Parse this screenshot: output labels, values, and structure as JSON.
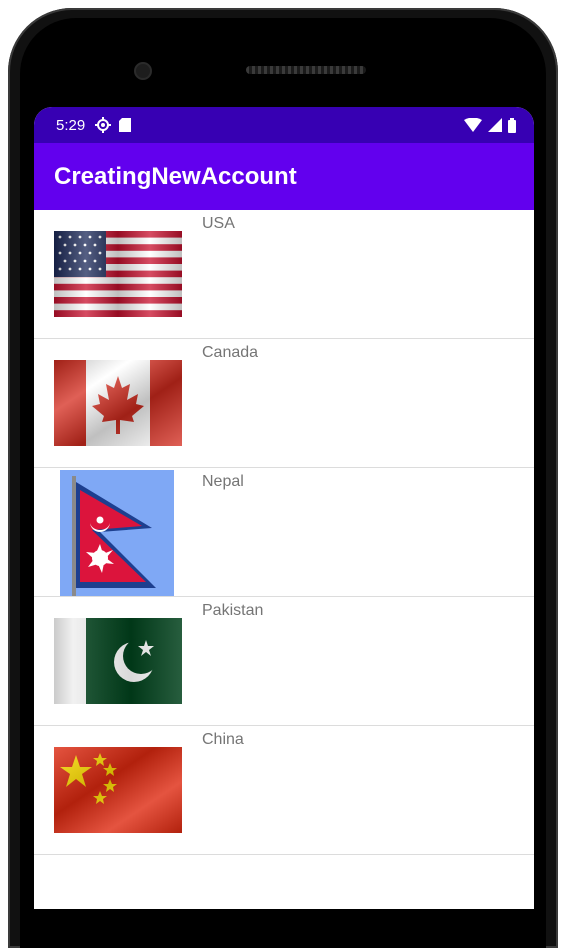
{
  "status_bar": {
    "time": "5:29",
    "icons_left": [
      "settings-icon",
      "sd-card-icon"
    ],
    "icons_right": [
      "wifi-icon",
      "signal-icon",
      "battery-icon"
    ],
    "background": "#3700b3"
  },
  "app_bar": {
    "title": "CreatingNewAccount",
    "background": "#6200ee"
  },
  "countries": [
    {
      "name": "USA",
      "flag_icon": "usa-flag-icon"
    },
    {
      "name": "Canada",
      "flag_icon": "canada-flag-icon"
    },
    {
      "name": "Nepal",
      "flag_icon": "nepal-flag-icon"
    },
    {
      "name": "Pakistan",
      "flag_icon": "pakistan-flag-icon"
    },
    {
      "name": "China",
      "flag_icon": "china-flag-icon"
    }
  ]
}
